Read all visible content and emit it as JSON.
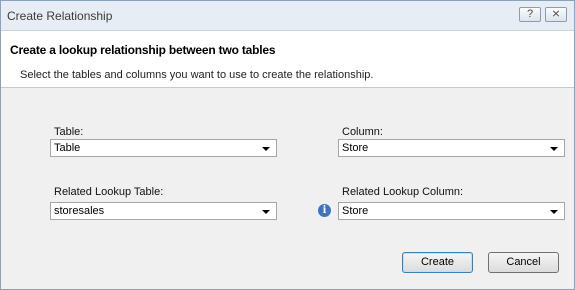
{
  "window": {
    "title": "Create Relationship",
    "help_button": "?",
    "close_button": "⨯"
  },
  "header": {
    "title": "Create a lookup relationship between two tables",
    "subtitle": "Select the tables and columns you want to use to create the relationship."
  },
  "form": {
    "table_label": "Table:",
    "table_value": "Table",
    "column_label": "Column:",
    "column_value": "Store",
    "related_table_label": "Related Lookup Table:",
    "related_table_value": "storesales",
    "related_column_label": "Related Lookup Column:",
    "related_column_value": "Store",
    "info_icon": "i"
  },
  "buttons": {
    "create": "Create",
    "cancel": "Cancel"
  }
}
